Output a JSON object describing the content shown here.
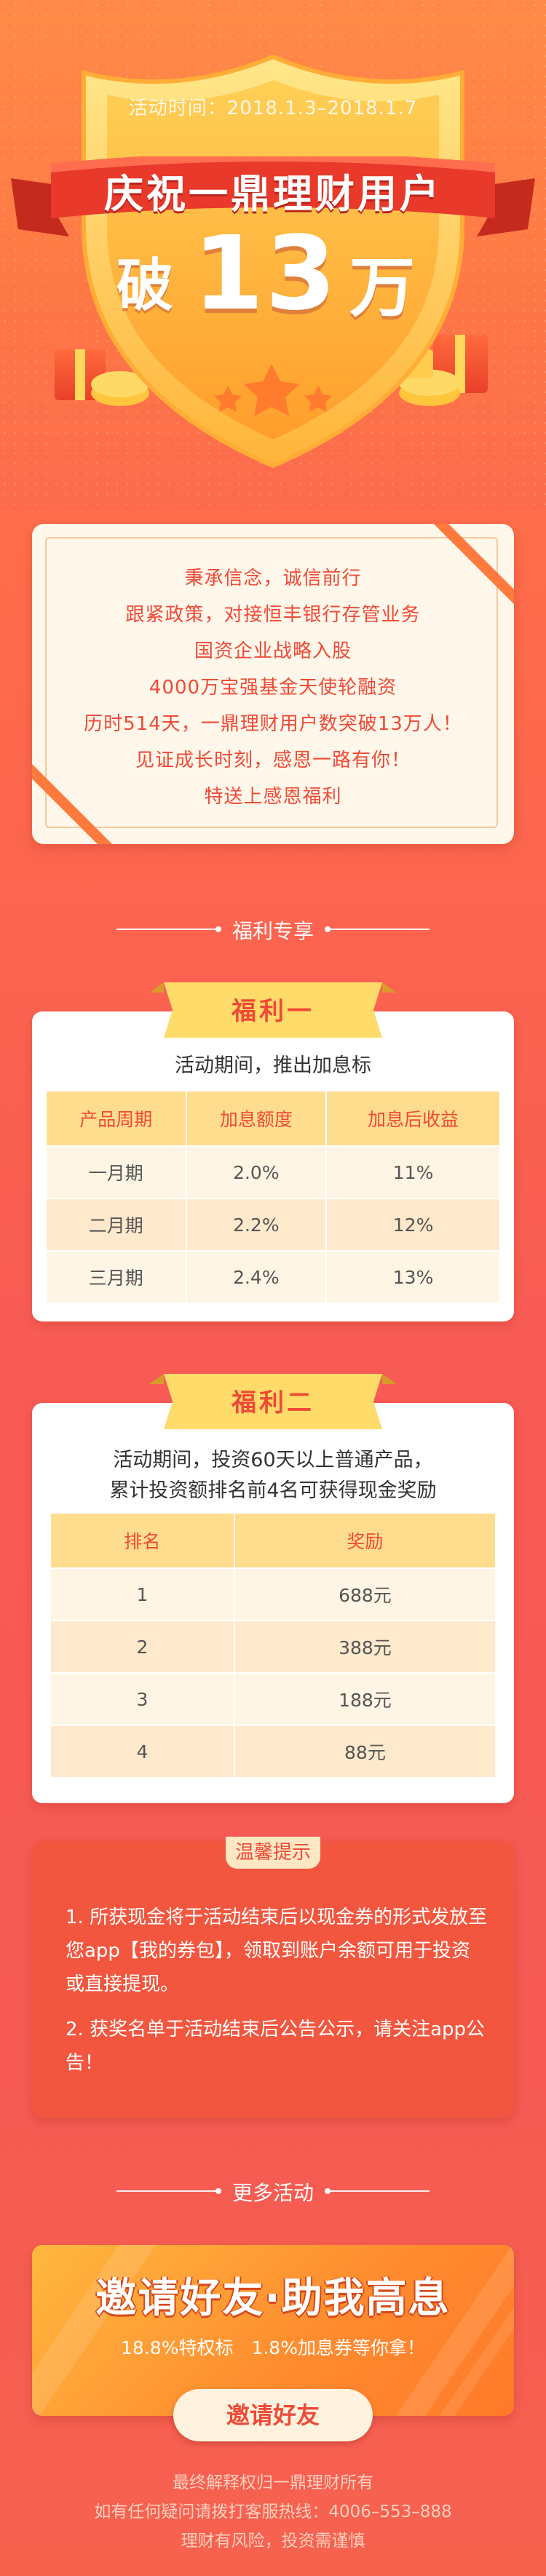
{
  "hero": {
    "date": "活动时间：2018.1.3–2018.1.7",
    "ribbon": "庆祝一鼎理财用户",
    "break_char": "破",
    "number": "13",
    "wan_char": "万"
  },
  "intro": {
    "lines": [
      "秉承信念，诚信前行",
      "跟紧政策，对接恒丰银行存管业务",
      "国资企业战略入股",
      "4000万宝强基金天使轮融资",
      "历时514天，一鼎理财用户数突破13万人！",
      "见证成长时刻，感恩一路有你！",
      "特送上感恩福利"
    ]
  },
  "sections": {
    "welfare": "福利专享",
    "more": "更多活动"
  },
  "benefit1": {
    "tag": "福利一",
    "desc": "活动期间，推出加息标",
    "headers": [
      "产品周期",
      "加息额度",
      "加息后收益"
    ],
    "rows": [
      [
        "一月期",
        "2.0%",
        "11%"
      ],
      [
        "二月期",
        "2.2%",
        "12%"
      ],
      [
        "三月期",
        "2.4%",
        "13%"
      ]
    ]
  },
  "benefit2": {
    "tag": "福利二",
    "desc_line1": "活动期间，投资60天以上普通产品，",
    "desc_line2": "累计投资额排名前4名可获得现金奖励",
    "headers": [
      "排名",
      "奖励"
    ],
    "rows": [
      [
        "1",
        "688元"
      ],
      [
        "2",
        "388元"
      ],
      [
        "3",
        "188元"
      ],
      [
        "4",
        "88元"
      ]
    ]
  },
  "notes": {
    "title": "温馨提示",
    "p1": "1. 所获现金将于活动结束后以现金券的形式发放至您app【我的券包】，领取到账户余额可用于投资或直接提现。",
    "p2": "2. 获奖名单于活动结束后公告公示，请关注app公告！"
  },
  "banner": {
    "title": "邀请好友·助我高息",
    "sub": "18.8%特权标　1.8%加息券等你拿！",
    "button": "邀请好友"
  },
  "footer": {
    "line1": "最终解释权归一鼎理财所有",
    "line2": "如有任何疑问请拨打客服热线：4006–553–888",
    "line3": "理财有风险，投资需谨慎"
  },
  "colors": {
    "accent": "#ef4a37",
    "gold": "#ffdd8e",
    "background": "#f85a55"
  }
}
